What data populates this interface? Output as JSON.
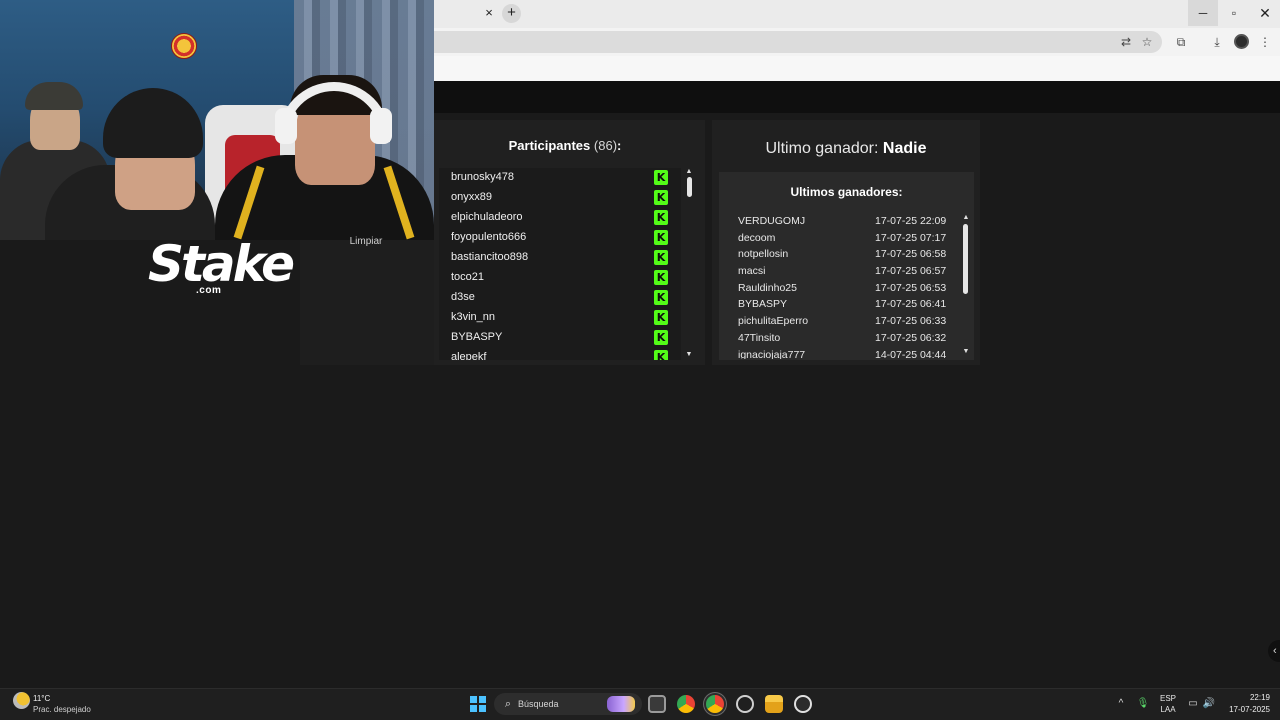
{
  "browser": {
    "tab_close": "×",
    "tab_new": "+",
    "window": {
      "minimize": "─",
      "maximize": "▫",
      "close": "✕"
    },
    "toolbar_icons": {
      "translate": "⇄",
      "bookmark": "☆",
      "extensions": "⧉",
      "download": "⤓",
      "menu": "⋮"
    }
  },
  "overlay": {
    "brand_word": "Stake",
    "brand_suffix": ".com",
    "clear_button": "Limpiar"
  },
  "participants": {
    "title": "Participantes",
    "count": "(86)",
    "title_suffix": ":",
    "items": [
      "brunosky478",
      "onyxx89",
      "elpichuladeoro",
      "foyopulento666",
      "bastiancitoo898",
      "toco21",
      "d3se",
      "k3vin_nn",
      "BYBASPY",
      "alepekf"
    ],
    "platform_icon": "K",
    "scroll_up": "▲",
    "scroll_down": "▼"
  },
  "winners": {
    "last_label": "Ultimo ganador:",
    "last_value": "Nadie",
    "list_title": "Ultimos ganadores:",
    "rows": [
      {
        "name": "VERDUGOMJ",
        "date": "17-07-25 22:09"
      },
      {
        "name": "decoom",
        "date": "17-07-25 07:17"
      },
      {
        "name": "notpellosin",
        "date": "17-07-25 06:58"
      },
      {
        "name": "macsi",
        "date": "17-07-25 06:57"
      },
      {
        "name": "Rauldinho25",
        "date": "17-07-25 06:53"
      },
      {
        "name": "BYBASPY",
        "date": "17-07-25 06:41"
      },
      {
        "name": "pichulitaEperro",
        "date": "17-07-25 06:33"
      },
      {
        "name": "47Tinsito",
        "date": "17-07-25 06:32"
      },
      {
        "name": "ignaciojaja777",
        "date": "14-07-25 04:44"
      }
    ],
    "scroll_up": "▲",
    "scroll_down": "▼"
  },
  "taskbar": {
    "weather_temp": "11°C",
    "weather_desc": "Prac. despejado",
    "search_placeholder": "Búsqueda",
    "search_icon": "⌕",
    "lang_top": "ESP",
    "lang_bottom": "LAA",
    "time": "22:19",
    "date": "17-07-2025",
    "tray_chevron": "^",
    "mic": "🎙",
    "volume": "🔊",
    "network": "▭"
  },
  "side_chevron": "‹",
  "colors": {
    "kick_green": "#53fc18",
    "page_bg": "#1a1a1a",
    "panel_bg": "#202020",
    "windows_blue": "#4cc2ff"
  }
}
